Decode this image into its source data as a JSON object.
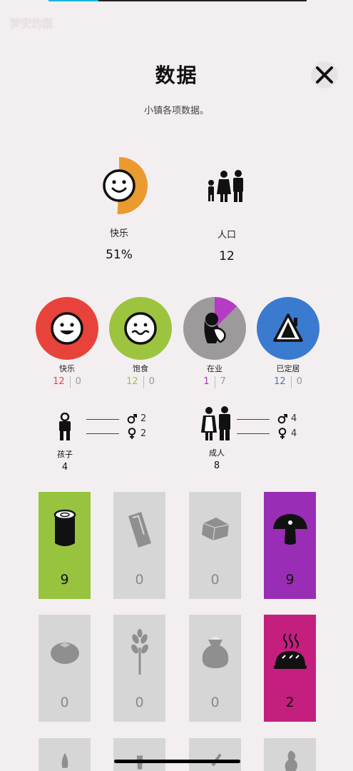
{
  "watermark": "梦安的国",
  "header": {
    "title": "数据",
    "subtitle": "小镇各项数据。"
  },
  "summary": {
    "happiness": {
      "label": "快乐",
      "value": "51%",
      "fraction": 0.51
    },
    "population": {
      "label": "人口",
      "value": "12"
    }
  },
  "circles": [
    {
      "label": "快乐",
      "count": "12",
      "zero": "0",
      "color": "#e8433b",
      "count_color": "#e8433b",
      "icon": "happy-face-icon"
    },
    {
      "label": "饱食",
      "count": "12",
      "zero": "0",
      "color": "#9dc43f",
      "count_color": "#9dc43f",
      "icon": "fed-face-icon"
    },
    {
      "label": "在业",
      "count": "1",
      "zero": "7",
      "color": "#9c9a9b",
      "count_color": "#a833b9",
      "icon": "worker-icon",
      "fill_fraction": 0.125
    },
    {
      "label": "已定居",
      "count": "12",
      "zero": "0",
      "color": "#3a7bd0",
      "count_color": "#3a7bd0",
      "icon": "house-icon"
    }
  ],
  "children": {
    "label": "孩子",
    "value": "4",
    "male": "2",
    "female": "2"
  },
  "adults": {
    "label": "成人",
    "value": "8",
    "male": "4",
    "female": "4"
  },
  "resources": [
    {
      "name": "wood",
      "icon": "log-icon",
      "value": "9",
      "color": "green"
    },
    {
      "name": "plank",
      "icon": "plank-icon",
      "value": "0",
      "color": "grey"
    },
    {
      "name": "stone",
      "icon": "stone-icon",
      "value": "0",
      "color": "grey"
    },
    {
      "name": "mushroom",
      "icon": "mushroom-icon",
      "value": "9",
      "color": "purple"
    },
    {
      "name": "tomato",
      "icon": "tomato-icon",
      "value": "0",
      "color": "grey"
    },
    {
      "name": "wheat",
      "icon": "wheat-icon",
      "value": "0",
      "color": "grey"
    },
    {
      "name": "flour",
      "icon": "flour-sack-icon",
      "value": "0",
      "color": "grey"
    },
    {
      "name": "bread",
      "icon": "bread-icon",
      "value": "2",
      "color": "pink"
    }
  ]
}
